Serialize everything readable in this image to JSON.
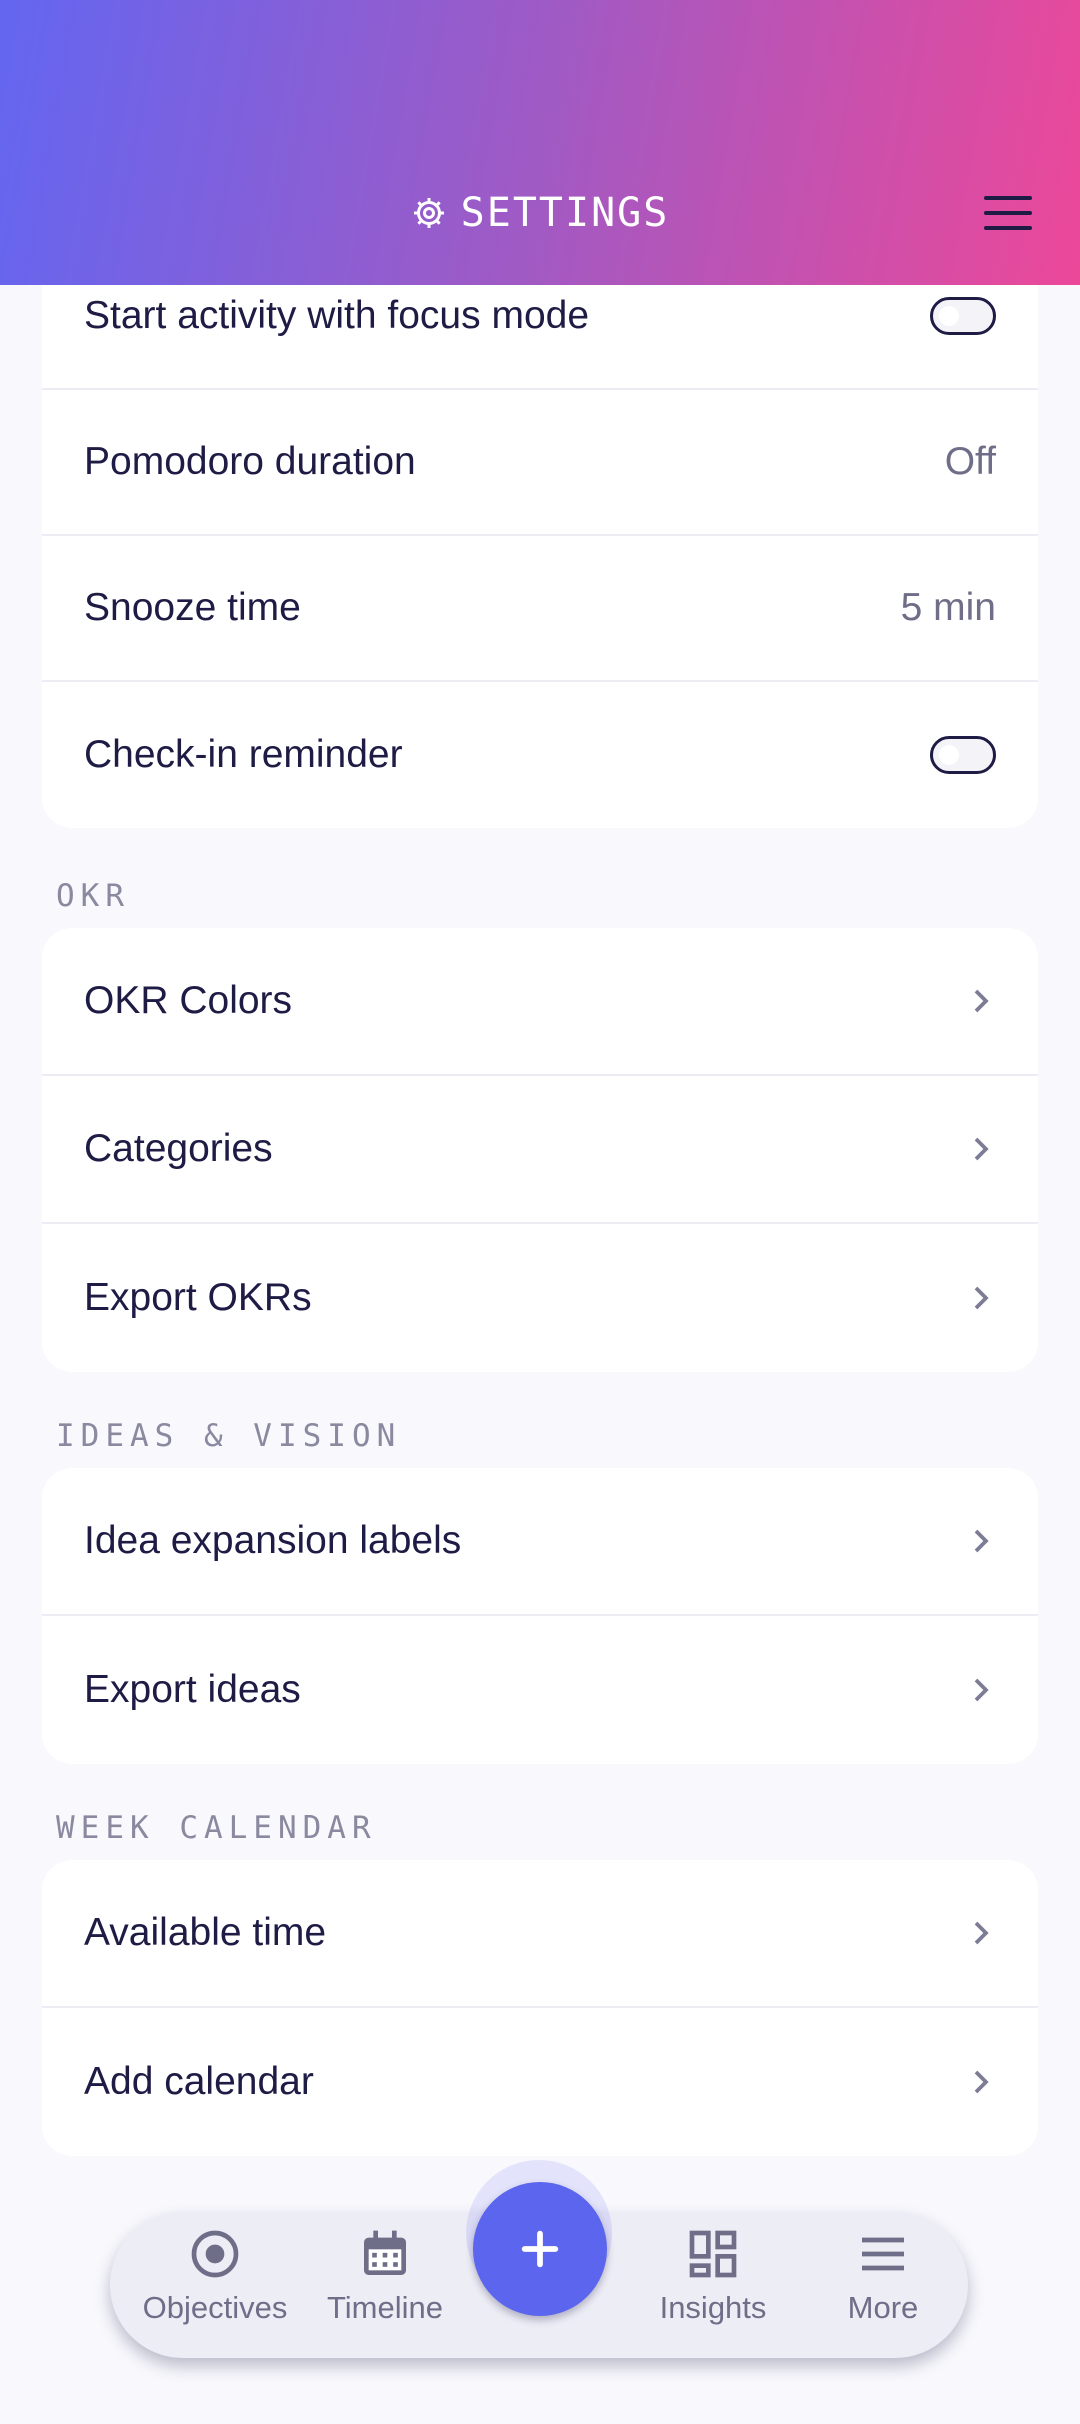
{
  "header": {
    "title": "SETTINGS",
    "icons": {
      "title": "gear-icon",
      "menu": "hamburger-menu-icon"
    }
  },
  "activity_card": {
    "rows": [
      {
        "label": "Start activity with focus mode",
        "type": "toggle",
        "on": false
      },
      {
        "label": "Pomodoro duration",
        "value": "Off"
      },
      {
        "label": "Snooze time",
        "value": "5 min"
      },
      {
        "label": "Check-in reminder",
        "type": "toggle",
        "on": false
      }
    ]
  },
  "okr": {
    "title": "OKR",
    "rows": [
      {
        "label": "OKR Colors"
      },
      {
        "label": "Categories"
      },
      {
        "label": "Export OKRs"
      }
    ]
  },
  "ideas": {
    "title": "IDEAS & VISION",
    "rows": [
      {
        "label": "Idea expansion labels"
      },
      {
        "label": "Export ideas"
      }
    ]
  },
  "week_calendar": {
    "title": "WEEK CALENDAR",
    "rows": [
      {
        "label": "Available time"
      },
      {
        "label": "Add calendar"
      }
    ]
  },
  "nav": {
    "items": [
      {
        "label": "Objectives",
        "icon": "target-icon"
      },
      {
        "label": "Timeline",
        "icon": "calendar-icon"
      },
      {
        "label": "Insights",
        "icon": "dashboard-icon"
      },
      {
        "label": "More",
        "icon": "menu-icon"
      }
    ],
    "fab_icon": "plus-icon"
  },
  "colors": {
    "accent": "#5b65ee",
    "gradient_start": "#6366f1",
    "gradient_end": "#ec4899",
    "text": "#1e1b45"
  }
}
